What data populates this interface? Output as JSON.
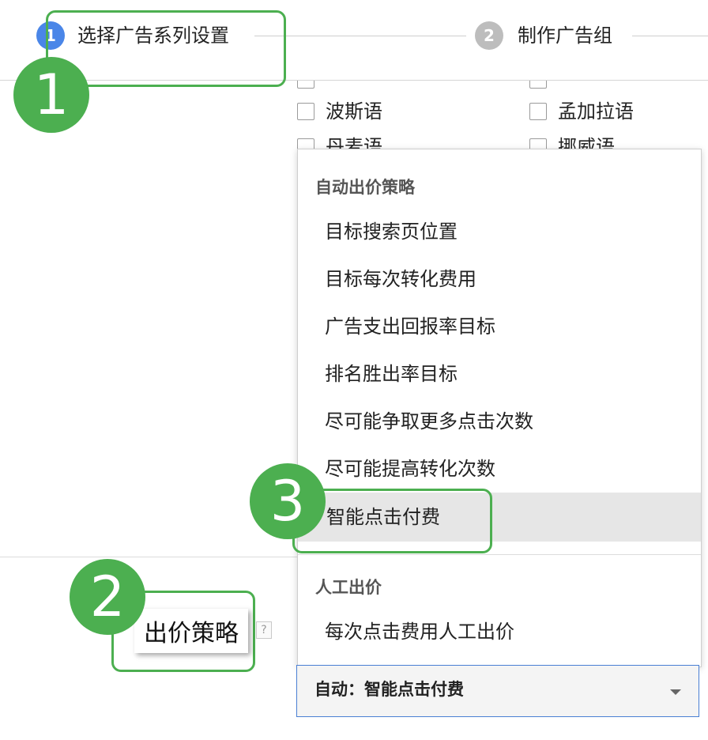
{
  "stepper": {
    "steps": [
      {
        "number": "1",
        "label": "选择广告系列设置"
      },
      {
        "number": "2",
        "label": "制作广告组"
      }
    ]
  },
  "languages": {
    "row_partial_top": [
      "",
      ""
    ],
    "row_visible": [
      "波斯语",
      "孟加拉语"
    ],
    "row_partial_bottom": [
      "丹麦语",
      "挪威语"
    ]
  },
  "bid_strategy": {
    "label": "出价策略",
    "help": "?",
    "selected_value": "自动：智能点击付费",
    "menu": {
      "auto_group_label": "自动出价策略",
      "auto_items": [
        "目标搜索页位置",
        "目标每次转化费用",
        "广告支出回报率目标",
        "排名胜出率目标",
        "尽可能争取更多点击次数",
        "尽可能提高转化次数",
        "智能点击付费"
      ],
      "manual_group_label": "人工出价",
      "manual_items": [
        "每次点击费用人工出价"
      ]
    }
  },
  "annotations": {
    "badge_1": "1",
    "badge_2": "2",
    "badge_3": "3"
  },
  "colors": {
    "annotation_green": "#4caf50",
    "step_active": "#4a86e8",
    "step_inactive": "#bdbdbd",
    "select_border": "#4a7fd4"
  }
}
